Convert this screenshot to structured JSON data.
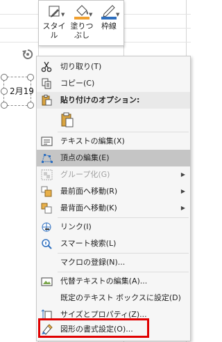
{
  "mini_toolbar": {
    "style_label": "スタイル",
    "fill_label_1": "塗りつ",
    "fill_label_2": "ぶし",
    "outline_label": "枠線",
    "fill_color": "#f0a030",
    "outline_color": "#2e6fbf"
  },
  "shape": {
    "text": "2月19"
  },
  "context_menu": {
    "cut": "切り取り(T)",
    "copy": "コピー(C)",
    "paste_options": "貼り付けのオプション:",
    "edit_text": "テキストの編集(X)",
    "edit_points": "頂点の編集(E)",
    "group": "グループ化(G)",
    "bring_to_front": "最前面へ移動(R)",
    "send_to_back": "最背面へ移動(K)",
    "link": "リンク(I)",
    "smart_lookup": "スマート検索(L)",
    "assign_macro": "マクロの登録(N)...",
    "edit_alt_text": "代替テキストの編集(A)...",
    "set_default_textbox": "既定のテキスト ボックスに設定(D)",
    "size_properties": "サイズとプロパティ(Z)...",
    "format_shape": "図形の書式設定(O)..."
  },
  "highlight_color": "#e00000"
}
